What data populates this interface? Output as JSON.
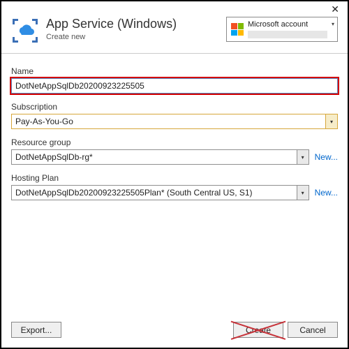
{
  "header": {
    "title": "App Service (Windows)",
    "subtitle": "Create new",
    "account_label": "Microsoft account"
  },
  "fields": {
    "name_label": "Name",
    "name_value": "DotNetAppSqlDb20200923225505",
    "subscription_label": "Subscription",
    "subscription_value": "Pay-As-You-Go",
    "resource_group_label": "Resource group",
    "resource_group_value": "DotNetAppSqlDb-rg*",
    "hosting_plan_label": "Hosting Plan",
    "hosting_plan_value": "DotNetAppSqlDb20200923225505Plan* (South Central US, S1)",
    "new_link": "New..."
  },
  "footer": {
    "export": "Export...",
    "create": "Create",
    "cancel": "Cancel"
  }
}
